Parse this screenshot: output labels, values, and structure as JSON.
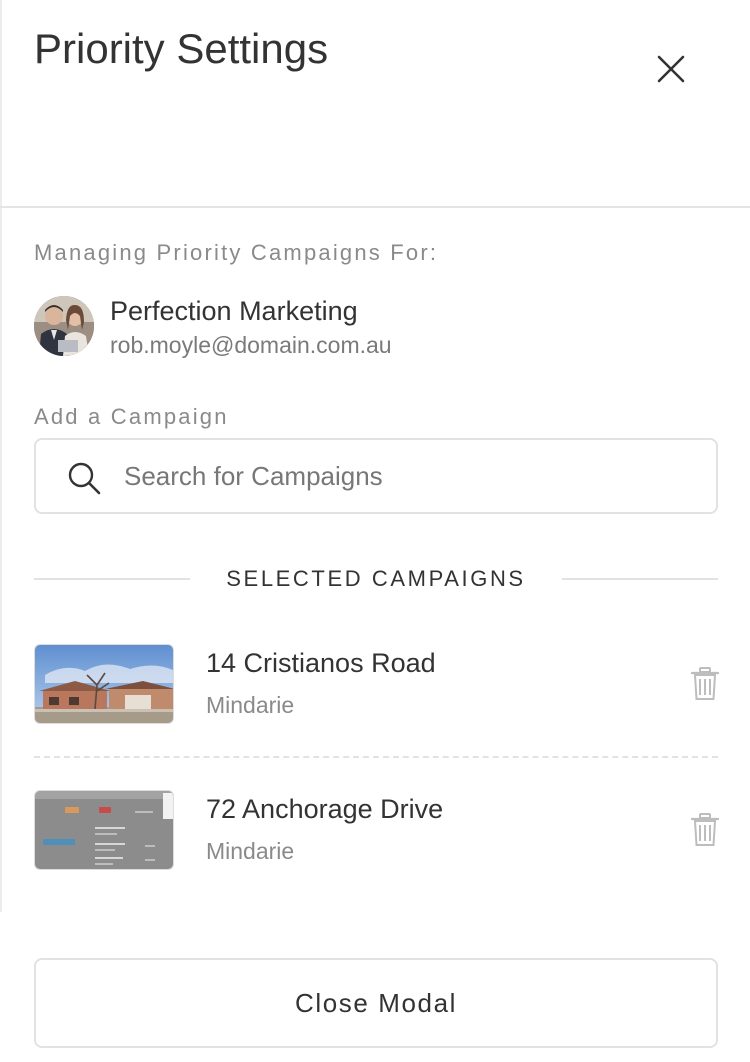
{
  "modal": {
    "title": "Priority Settings",
    "close_icon": "close-icon"
  },
  "managing": {
    "label": "Managing Priority Campaigns For:",
    "account_name": "Perfection Marketing",
    "account_email": "rob.moyle@domain.com.au"
  },
  "add_campaign": {
    "label": "Add a Campaign",
    "placeholder": "Search for Campaigns",
    "icon": "search-icon"
  },
  "selected": {
    "heading": "SELECTED CAMPAIGNS",
    "campaigns": [
      {
        "title": "14 Cristianos Road",
        "suburb": "Mindarie"
      },
      {
        "title": "72 Anchorage Drive",
        "suburb": "Mindarie"
      }
    ]
  },
  "footer": {
    "close_label": "Close Modal"
  },
  "colors": {
    "text": "#333333",
    "muted": "#8a8a8a",
    "border": "#e2e2e2"
  }
}
